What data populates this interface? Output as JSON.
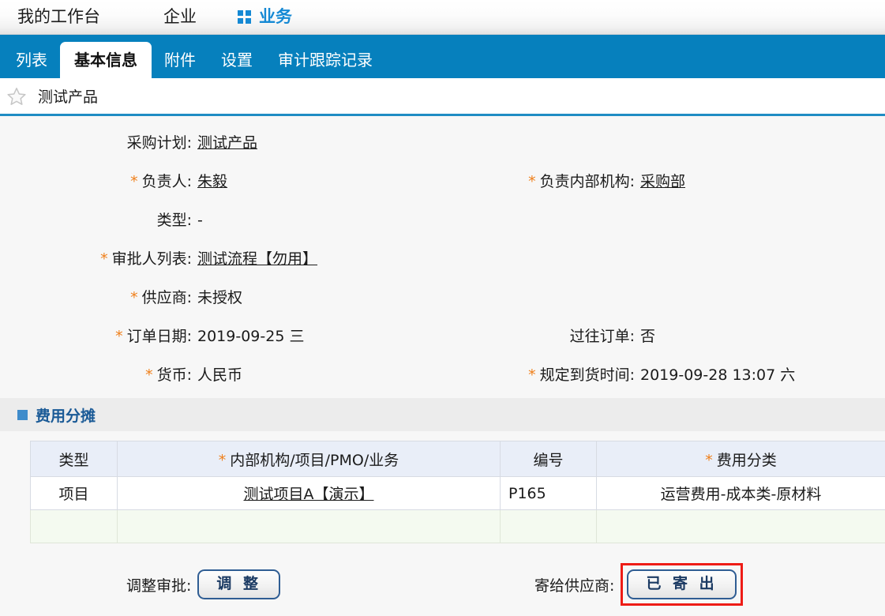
{
  "topbar": {
    "items": [
      {
        "label": "我的工作台",
        "active": false,
        "icon": null
      },
      {
        "label": "企业",
        "active": false,
        "icon": null
      },
      {
        "label": "业务",
        "active": true,
        "icon": "grid-icon"
      }
    ]
  },
  "tabs": [
    {
      "label": "列表",
      "active": false
    },
    {
      "label": "基本信息",
      "active": true
    },
    {
      "label": "附件",
      "active": false
    },
    {
      "label": "设置",
      "active": false
    },
    {
      "label": "审计跟踪记录",
      "active": false
    }
  ],
  "titlebar": {
    "favorite_icon": "star-icon",
    "title": "测试产品"
  },
  "form": {
    "rows": [
      {
        "left": {
          "required": false,
          "label": "采购计划:",
          "value": "测试产品",
          "link": true
        },
        "right": {
          "required": false,
          "label": "",
          "value": "",
          "link": false
        }
      },
      {
        "left": {
          "required": true,
          "label": "负责人:",
          "value": "朱毅",
          "link": true
        },
        "right": {
          "required": true,
          "label": "负责内部机构:",
          "value": "采购部",
          "link": true
        }
      },
      {
        "left": {
          "required": false,
          "label": "类型:",
          "value": "-",
          "link": false
        },
        "right": {
          "required": false,
          "label": "",
          "value": "",
          "link": false
        }
      },
      {
        "left": {
          "required": true,
          "label": "审批人列表:",
          "value": "测试流程【勿用】",
          "link": true
        },
        "right": {
          "required": false,
          "label": "",
          "value": "",
          "link": false
        }
      },
      {
        "left": {
          "required": true,
          "label": "供应商:",
          "value": "未授权",
          "link": false
        },
        "right": {
          "required": false,
          "label": "",
          "value": "",
          "link": false
        }
      },
      {
        "left": {
          "required": true,
          "label": "订单日期:",
          "value": "2019-09-25 三",
          "link": false
        },
        "right": {
          "required": false,
          "label": "过往订单:",
          "value": "否",
          "link": false
        }
      },
      {
        "left": {
          "required": true,
          "label": "货币:",
          "value": "人民币",
          "link": false
        },
        "right": {
          "required": true,
          "label": "规定到货时间:",
          "value": "2019-09-28 13:07 六",
          "link": false
        }
      }
    ]
  },
  "section": {
    "bullet_icon": "blue-square-icon",
    "title": "费用分摊"
  },
  "cost_table": {
    "columns": [
      {
        "label": "类型",
        "required": false
      },
      {
        "label": "内部机构/项目/PMO/业务",
        "required": true
      },
      {
        "label": "编号",
        "required": false
      },
      {
        "label": "费用分类",
        "required": true
      }
    ],
    "rows": [
      {
        "type": "项目",
        "org": "测试项目A【演示】",
        "code": "P165",
        "category": "运营费用-成本类-原材料"
      }
    ],
    "empty_row": true
  },
  "actions": {
    "adjust": {
      "label": "调整审批:",
      "button": "调 整",
      "highlighted": false
    },
    "send": {
      "label": "寄给供应商:",
      "button": "已 寄 出",
      "highlighted": true
    }
  },
  "colors": {
    "tabbar_blue": "#0680bd",
    "accent_blue": "#1589d4",
    "required_orange": "#ef7f1a",
    "section_title_blue": "#1a5a96",
    "highlight_red": "#ee1c16",
    "table_header_bg": "#e9eef8",
    "empty_row_green": "#f4faf0"
  }
}
